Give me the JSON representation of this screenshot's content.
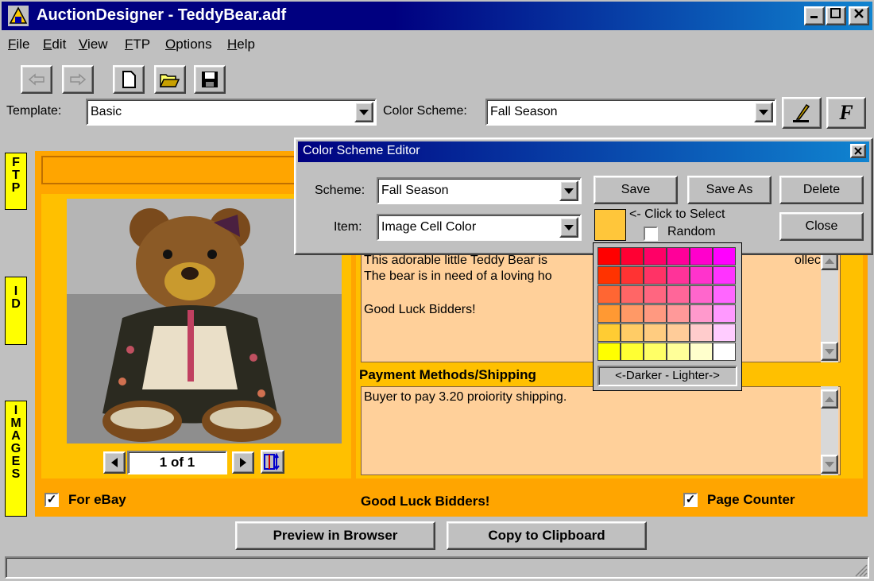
{
  "window": {
    "title": "AuctionDesigner - TeddyBear.adf",
    "app_icon": "auction-designer-icon"
  },
  "menu": [
    {
      "label": "File",
      "mnemonic": "F",
      "rest": "ile"
    },
    {
      "label": "Edit",
      "mnemonic": "E",
      "rest": "dit"
    },
    {
      "label": "View",
      "mnemonic": "V",
      "rest": "iew"
    },
    {
      "label": "FTP",
      "mnemonic": "F",
      "rest": "TP",
      "pre": ""
    },
    {
      "label": "Options",
      "mnemonic": "O",
      "rest": "ptions"
    },
    {
      "label": "Help",
      "mnemonic": "H",
      "rest": "elp"
    }
  ],
  "toolbar": {
    "template_label": "Template:",
    "template_value": "Basic",
    "scheme_label": "Color Scheme:",
    "scheme_value": "Fall Season",
    "font_button": "F"
  },
  "side_tabs": {
    "ftp": "FTP",
    "id": "ID",
    "images": "IMAGES"
  },
  "image_nav": {
    "counter": "1 of 1"
  },
  "description": {
    "text_line1": "This adorable little Teddy Bear is",
    "text_line1_end": "ollector.",
    "text_line2": "The bear is in need of a loving ho",
    "text_line3": "Good Luck Bidders!"
  },
  "payment": {
    "heading": "Payment Methods/Shipping",
    "text": "Buyer to pay 3.20 proiority shipping."
  },
  "footer_bar": {
    "for_ebay_label": "For eBay",
    "for_ebay_checked": true,
    "center_text": "Good Luck Bidders!",
    "page_counter_label": "Page Counter",
    "page_counter_checked": true
  },
  "buttons": {
    "preview": "Preview in Browser",
    "copy": "Copy to Clipboard"
  },
  "dialog": {
    "title": "Color Scheme Editor",
    "scheme_label": "Scheme:",
    "scheme_value": "Fall Season",
    "item_label": "Item:",
    "item_value": "Image Cell Color",
    "save": "Save",
    "save_as": "Save As",
    "delete": "Delete",
    "close": "Close",
    "click_to_select": "<- Click to Select",
    "random_label": "Random",
    "random_checked": false,
    "selected_color": "#ffc63a"
  },
  "palette": {
    "footer": "<-Darker - Lighter->",
    "rows": [
      [
        "#ff0000",
        "#ff0033",
        "#ff0066",
        "#ff0099",
        "#ff00cc",
        "#ff00ff"
      ],
      [
        "#ff3300",
        "#ff3333",
        "#ff3366",
        "#ff3399",
        "#ff33cc",
        "#ff33ff"
      ],
      [
        "#ff6633",
        "#ff6666",
        "#ff6680",
        "#ff6699",
        "#ff66cc",
        "#ff66ff"
      ],
      [
        "#ff9933",
        "#ff9966",
        "#ff9980",
        "#ff9999",
        "#ff99cc",
        "#ff99ff"
      ],
      [
        "#ffcc33",
        "#ffcc66",
        "#ffcc80",
        "#ffcc99",
        "#ffcccc",
        "#ffccff"
      ],
      [
        "#ffff00",
        "#ffff33",
        "#ffff66",
        "#ffff99",
        "#ffffcc",
        "#ffffff"
      ]
    ]
  },
  "colors": {
    "orange_bar": "#ffa500",
    "gold_frame": "#ffc000",
    "text_bg": "#ffd09a",
    "tab_yellow": "#ffff00"
  }
}
